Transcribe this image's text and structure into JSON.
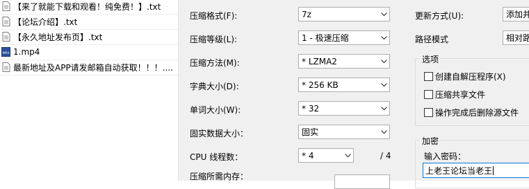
{
  "files": [
    {
      "name": "【来了就能下载和观看！纯免费！】.txt",
      "icon": "text-file-icon"
    },
    {
      "name": "【论坛介绍】.txt",
      "icon": "text-file-icon"
    },
    {
      "name": "【永久地址发布页】.txt",
      "icon": "text-file-icon"
    },
    {
      "name": "1.mp4",
      "icon": "mp4-file-icon",
      "icon_text": "MP4"
    },
    {
      "name": "最新地址及APP请发邮箱自动获取！！！....",
      "icon": "text-file-icon"
    }
  ],
  "form": {
    "format": {
      "label": "压缩格式(F):",
      "value": "7z"
    },
    "level": {
      "label": "压缩等级(L):",
      "value": "1 - 极速压缩"
    },
    "method": {
      "label": "压缩方法(M):",
      "value": "* LZMA2"
    },
    "dict": {
      "label": "字典大小(D):",
      "value": "* 256 KB"
    },
    "word": {
      "label": "单词大小(W):",
      "value": "* 32"
    },
    "solid": {
      "label": "固实数据大小：",
      "value": "固实"
    },
    "threads": {
      "label": "CPU 线程数：",
      "value": "* 4",
      "max": "/ 4"
    },
    "memory": {
      "label": "压缩所需内存："
    }
  },
  "update": {
    "mode_label": "更新方式(U):",
    "mode_value": "添加并",
    "path_label": "路径模式",
    "path_value": "相对路"
  },
  "options": {
    "title": "选项",
    "items": [
      {
        "label": "创建自解压程序(X)",
        "checked": false
      },
      {
        "label": "压缩共享文件",
        "checked": false
      },
      {
        "label": "操作完成后删除源文件",
        "checked": false
      }
    ]
  },
  "encryption": {
    "title": "加密",
    "password_label": "输入密码：",
    "password_value": "上老王论坛当老王"
  }
}
